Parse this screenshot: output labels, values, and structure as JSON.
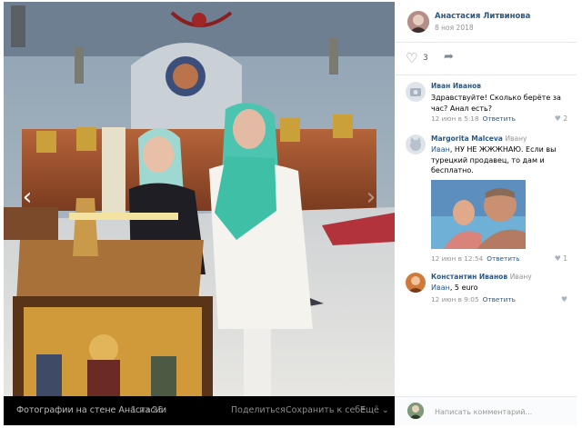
{
  "photo": {
    "bottom_bar": {
      "title": "Фотографии на стене Анастасии",
      "counter": "1 из 25",
      "share": "Поделиться",
      "save": "Сохранить к себе",
      "more": "Ещё ⌄"
    },
    "prev_icon": "chevron-left-icon",
    "next_icon": "chevron-right-icon"
  },
  "post": {
    "author_name": "Анастасия Литвинова",
    "date": "8 ноя 2018",
    "likes": "3"
  },
  "comments": [
    {
      "name": "Иван Иванов",
      "reply_to": "",
      "address": "",
      "text": "Здравствуйте! Сколько берёте за час? Анал есть?",
      "time": "12 июн в 5:18",
      "reply": "Ответить",
      "likes": "2"
    },
    {
      "name": "Margorita Malceva",
      "reply_to": "Ивану",
      "address": "Иван",
      "text": ", НУ НЕ ЖЖЖНАЮ. Если вы турецкий продавец, то дам и бесплатно.",
      "time": "12 июн в 12:54",
      "reply": "Ответить",
      "likes": "1"
    },
    {
      "name": "Константин Иванов",
      "reply_to": "Ивану",
      "address": "Иван",
      "text": ", 5 euro",
      "time": "12 июн в 9:05",
      "reply": "Ответить",
      "likes": ""
    }
  ],
  "comment_input": {
    "placeholder": "Написать комментарий..."
  }
}
